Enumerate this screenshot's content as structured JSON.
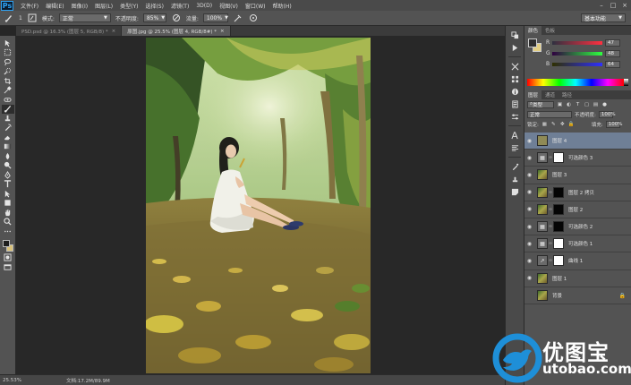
{
  "menubar": {
    "items": [
      "文件(F)",
      "编辑(E)",
      "图像(I)",
      "图层(L)",
      "类型(Y)",
      "选择(S)",
      "滤镜(T)",
      "3D(D)",
      "视图(V)",
      "窗口(W)",
      "帮助(H)"
    ],
    "logo": "Ps",
    "window_controls": [
      "–",
      "□",
      "×"
    ]
  },
  "options": {
    "brush_size": "1",
    "mode_label": "模式:",
    "mode_value": "正常",
    "opacity_label": "不透明度:",
    "opacity_value": "85%",
    "flow_label": "流量:",
    "flow_value": "100%",
    "workspace": "基本功能"
  },
  "tabs": [
    {
      "label": "PSD.psd @ 16.3% (图层 5, RGB/8) *"
    },
    {
      "label": "原图.jpg @ 25.5% (图层 4, RGB/8#) *"
    }
  ],
  "status": {
    "zoom": "25.53%",
    "doc_size": "文档:17.2M/89.9M"
  },
  "color_panel": {
    "tabs": [
      "颜色",
      "色板"
    ],
    "channels": [
      {
        "name": "R",
        "value": "47",
        "color": "#e04040"
      },
      {
        "name": "G",
        "value": "48",
        "color": "#40c040"
      },
      {
        "name": "B",
        "value": "64",
        "color": "#4060e0"
      }
    ]
  },
  "layers_panel": {
    "tabs": [
      "图层",
      "通道",
      "路径"
    ],
    "filter_type": "类型",
    "blend_mode": "正常",
    "opacity_label": "不透明度:",
    "opacity_value": "100%",
    "lock_label": "锁定:",
    "fill_label": "填充:",
    "fill_value": "100%",
    "layers": [
      {
        "name": "图层 4"
      },
      {
        "name": "可选颜色 3"
      },
      {
        "name": "图层 3"
      },
      {
        "name": "图层 2 拷贝"
      },
      {
        "name": "图层 2"
      },
      {
        "name": "可选颜色 2"
      },
      {
        "name": "可选颜色 1"
      },
      {
        "name": "曲线 1"
      },
      {
        "name": "图层 1"
      },
      {
        "name": "背景"
      }
    ]
  },
  "watermark": {
    "brand": "优图宝",
    "url": "utobao.com"
  }
}
